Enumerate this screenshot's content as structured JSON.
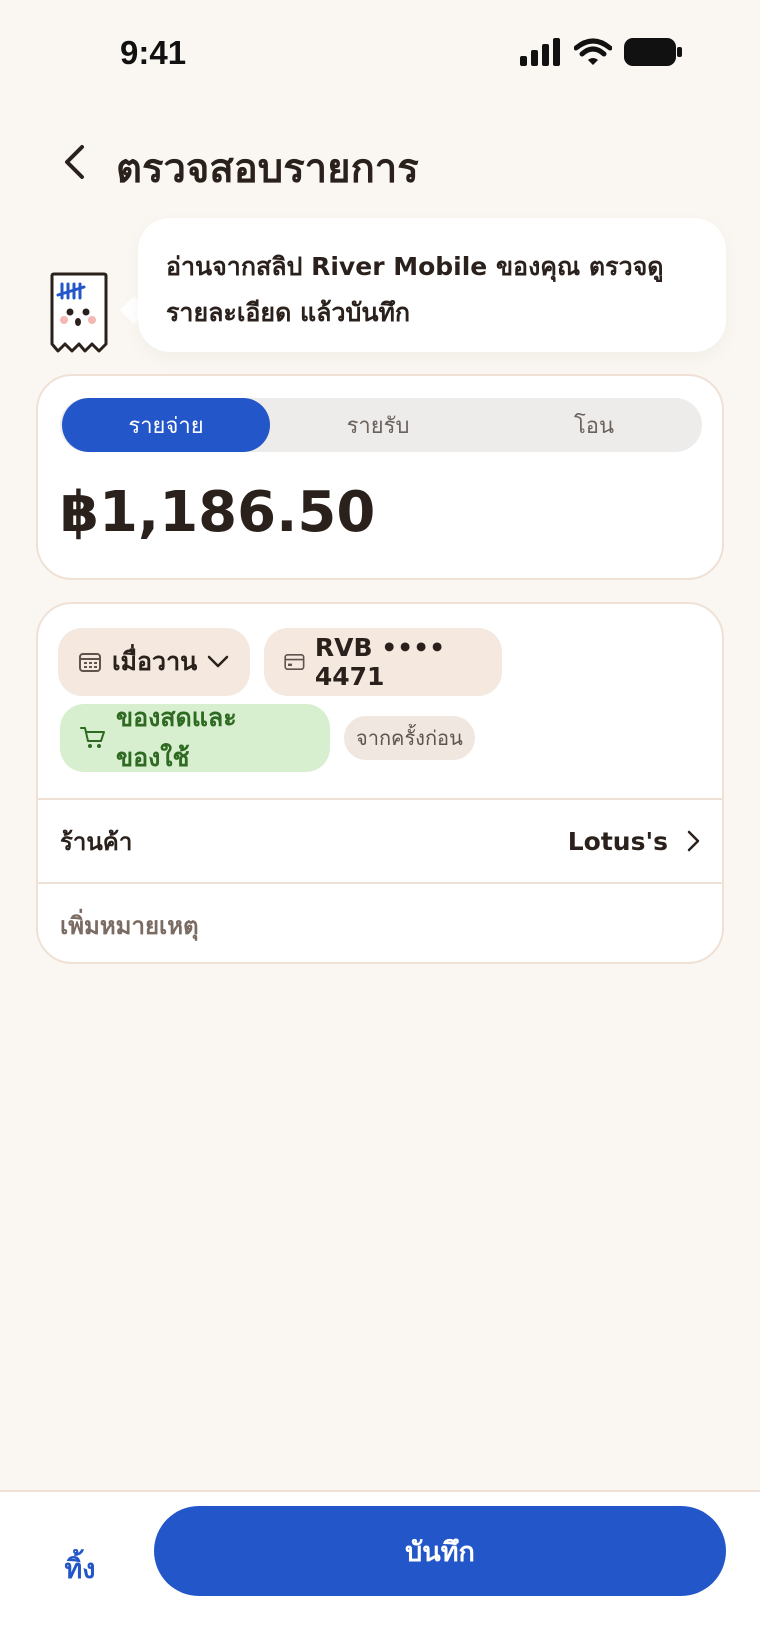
{
  "status_bar": {
    "time": "9:41"
  },
  "header": {
    "title": "ตรวจสอบรายการ"
  },
  "assistant": {
    "message": "อ่านจากสลิป River Mobile ของคุณ ตรวจดูรายละเอียด แล้วบันทึก"
  },
  "type_tabs": [
    {
      "label": "รายจ่าย",
      "selected": true
    },
    {
      "label": "รายรับ",
      "selected": false
    },
    {
      "label": "โอน",
      "selected": false
    }
  ],
  "amount": {
    "display": "฿1,186.50"
  },
  "chips": {
    "date": "เมื่อวาน",
    "account": "RVB •••• 4471",
    "category": "ของสดและของใช้",
    "category_hint": "จากครั้งก่อน"
  },
  "merchant": {
    "label": "ร้านค้า",
    "value": "Lotus's"
  },
  "note": {
    "placeholder": "เพิ่มหมายเหตุ"
  },
  "actions": {
    "discard": "ทิ้ง",
    "save": "บันทึก"
  },
  "colors": {
    "accent": "#2356c8",
    "background": "#faf7f2",
    "category_bg": "#d7efcf",
    "category_text": "#2f6a22",
    "chip_bg": "#f4e8df"
  }
}
